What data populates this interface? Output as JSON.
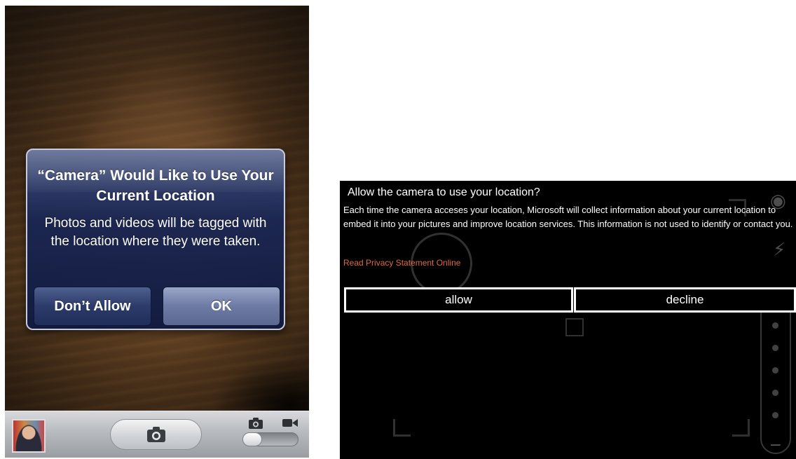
{
  "ios": {
    "alert_title": "“Camera” Would Like to Use Your Current Location",
    "alert_message": "Photos and videos will be tagged with the location where they were taken.",
    "dont_allow_label": "Don’t Allow",
    "ok_label": "OK",
    "toolbar": {
      "mode_photo_icon": "camera-icon",
      "mode_video_icon": "video-camera-icon",
      "shutter_icon": "camera-icon"
    }
  },
  "wp": {
    "title": "Allow the camera to use your location?",
    "body": "Each time the camera acceses your location, Microsoft will collect information about your current location to embed it into your pictures and improve location services. This information is not used to identify or contact you.",
    "privacy_link": "Read Privacy Statement Online",
    "allow_label": "allow",
    "decline_label": "decline",
    "link_color": "#e06a3a"
  }
}
